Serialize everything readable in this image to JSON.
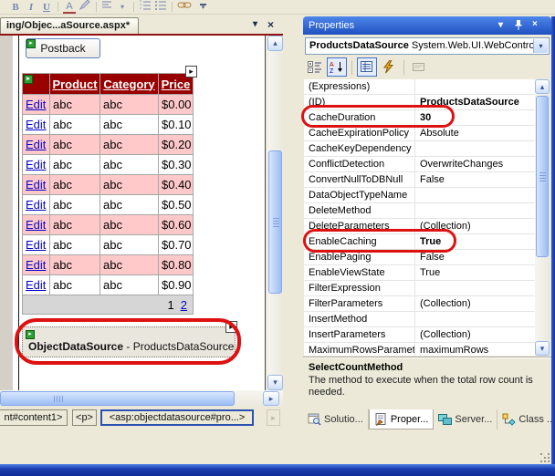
{
  "icons": {
    "glyph_arrow": "▸",
    "smart_tag": "▸",
    "chevron_down": "▾",
    "close": "×",
    "scroll_up": "▴",
    "scroll_down": "▾",
    "scroll_right": "▸"
  },
  "colors": {
    "grid_header": "#990000",
    "grid_alt_row": "#ffc9c9",
    "annotation_red": "#de1111",
    "link_blue": "#0404cc",
    "titlebar_blue": "#2a5fd0"
  },
  "format_toolbar": {
    "bold": "B",
    "italic": "I",
    "underline": "U",
    "font_color": "A"
  },
  "doc": {
    "tab_label": "ing/Objec...aSource.aspx*",
    "postback": "Postback",
    "grid": {
      "headers": [
        "Product",
        "Category",
        "Price"
      ],
      "rows": [
        {
          "edit": "Edit",
          "product": "abc",
          "category": "abc",
          "price": "$0.00"
        },
        {
          "edit": "Edit",
          "product": "abc",
          "category": "abc",
          "price": "$0.10"
        },
        {
          "edit": "Edit",
          "product": "abc",
          "category": "abc",
          "price": "$0.20"
        },
        {
          "edit": "Edit",
          "product": "abc",
          "category": "abc",
          "price": "$0.30"
        },
        {
          "edit": "Edit",
          "product": "abc",
          "category": "abc",
          "price": "$0.40"
        },
        {
          "edit": "Edit",
          "product": "abc",
          "category": "abc",
          "price": "$0.50"
        },
        {
          "edit": "Edit",
          "product": "abc",
          "category": "abc",
          "price": "$0.60"
        },
        {
          "edit": "Edit",
          "product": "abc",
          "category": "abc",
          "price": "$0.70"
        },
        {
          "edit": "Edit",
          "product": "abc",
          "category": "abc",
          "price": "$0.80"
        },
        {
          "edit": "Edit",
          "product": "abc",
          "category": "abc",
          "price": "$0.90"
        }
      ],
      "pager_current": "1",
      "pager_next": "2"
    },
    "ods_title": "ObjectDataSource",
    "ods_suffix": " - ProductsDataSource",
    "tag_path": [
      "nt#content1>",
      "<p>",
      "<asp:objectdatasource#pro...>"
    ]
  },
  "props": {
    "title": "Properties",
    "object_name": "ProductsDataSource",
    "object_type": "System.Web.UI.WebControl",
    "rows": [
      {
        "name": "(Expressions)",
        "value": ""
      },
      {
        "name": "(ID)",
        "value": "ProductsDataSource",
        "bold": true
      },
      {
        "name": "CacheDuration",
        "value": "30",
        "bold": true,
        "circled": true
      },
      {
        "name": "CacheExpirationPolicy",
        "value": "Absolute"
      },
      {
        "name": "CacheKeyDependency",
        "value": ""
      },
      {
        "name": "ConflictDetection",
        "value": "OverwriteChanges"
      },
      {
        "name": "ConvertNullToDBNull",
        "value": "False"
      },
      {
        "name": "DataObjectTypeName",
        "value": ""
      },
      {
        "name": "DeleteMethod",
        "value": ""
      },
      {
        "name": "DeleteParameters",
        "value": "(Collection)"
      },
      {
        "name": "EnableCaching",
        "value": "True",
        "bold": true,
        "circled": true
      },
      {
        "name": "EnablePaging",
        "value": "False"
      },
      {
        "name": "EnableViewState",
        "value": "True"
      },
      {
        "name": "FilterExpression",
        "value": ""
      },
      {
        "name": "FilterParameters",
        "value": "(Collection)"
      },
      {
        "name": "InsertMethod",
        "value": ""
      },
      {
        "name": "InsertParameters",
        "value": "(Collection)"
      },
      {
        "name": "MaximumRowsParamet",
        "value": "maximumRows"
      }
    ],
    "description_title": "SelectCountMethod",
    "description_text": "The method to execute when the total row count is needed.",
    "tabs": [
      "Solutio...",
      "Proper...",
      "Server...",
      "Class ..."
    ]
  }
}
